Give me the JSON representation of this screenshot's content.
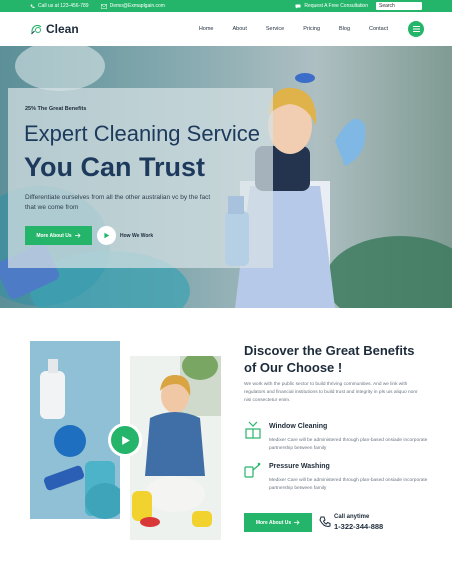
{
  "topbar": {
    "phone": "Call us at 123-456-789",
    "email": "Demo@Exmaplgain.com",
    "consultation": "Request A Free Consultation",
    "search_placeholder": "Search"
  },
  "brand": {
    "name": "Clean"
  },
  "nav": {
    "items": [
      "Home",
      "About",
      "Service",
      "Pricing",
      "Blog",
      "Contact"
    ]
  },
  "hero": {
    "kicker": "25% The Great Benefits",
    "title_line1": "Expert Cleaning Service",
    "title_line2": "You Can Trust",
    "description": "Differentiate ourselves from all the other australian vc by the fact that we come from",
    "cta_label": "More About Us",
    "video_label": "How We Work"
  },
  "benefits": {
    "title": "Discover the Great Benefits of Our Choose !",
    "description": "We work with the public sector to build thriving communities. And we link with regulators and financial institutions to build trust and integrity in pls uis aliquo nonr nisi consectetur enim.",
    "features": [
      {
        "title": "Window Cleaning",
        "icon": "window-cleaning-icon",
        "text": "Medixer Care will be administered through plan-based onsiade incorporate partnership between family"
      },
      {
        "title": "Pressure Washing",
        "icon": "pressure-washing-icon",
        "text": "Medixer Care will be administered through plan-based onsiade incorporate partnership between family"
      }
    ],
    "cta_label": "More About Us",
    "call_label": "Call anytime",
    "call_number": "1-322-344-888"
  },
  "colors": {
    "accent": "#25b56a",
    "heading": "#1d3a5c"
  }
}
